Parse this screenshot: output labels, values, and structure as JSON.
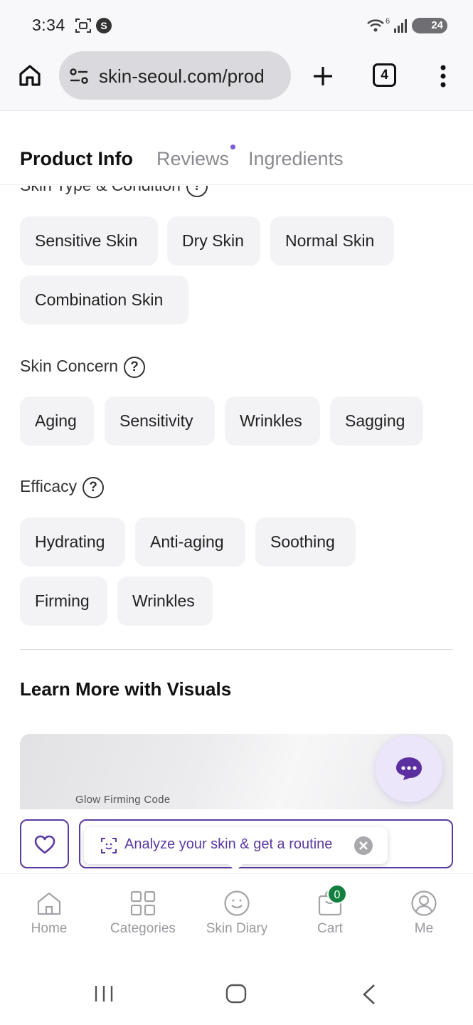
{
  "status_bar": {
    "time": "3:34",
    "wifi_label": "6",
    "battery": "24"
  },
  "browser": {
    "url": "skin-seoul.com/prod",
    "tab_count": "4"
  },
  "tabs": [
    {
      "label": "Product Info",
      "active": true
    },
    {
      "label": "Reviews",
      "active": false,
      "has_dot": true
    },
    {
      "label": "Ingredients",
      "active": false
    }
  ],
  "sections": {
    "skin_type": {
      "title": "Skin Type & Condition",
      "chips": [
        "Sensitive Skin",
        "Dry Skin",
        "Normal Skin",
        "Combination Skin"
      ]
    },
    "skin_concern": {
      "title": "Skin Concern",
      "chips": [
        "Aging",
        "Sensitivity",
        "Wrinkles",
        "Sagging"
      ]
    },
    "efficacy": {
      "title": "Efficacy",
      "chips": [
        "Hydrating",
        "Anti-aging",
        "Soothing",
        "Firming",
        "Wrinkles"
      ]
    },
    "visuals": {
      "title": "Learn More with Visuals",
      "caption": "Glow Firming Code"
    }
  },
  "help_glyph": "?",
  "action_bar": {
    "analyze_text": "Analyze your skin & get a routine"
  },
  "bottom_nav": {
    "items": [
      "Home",
      "Categories",
      "Skin Diary",
      "Cart",
      "Me"
    ],
    "cart_count": "0"
  },
  "colors": {
    "accent": "#5b3aa0",
    "badge": "#138040",
    "dot": "#7c5cd6"
  }
}
